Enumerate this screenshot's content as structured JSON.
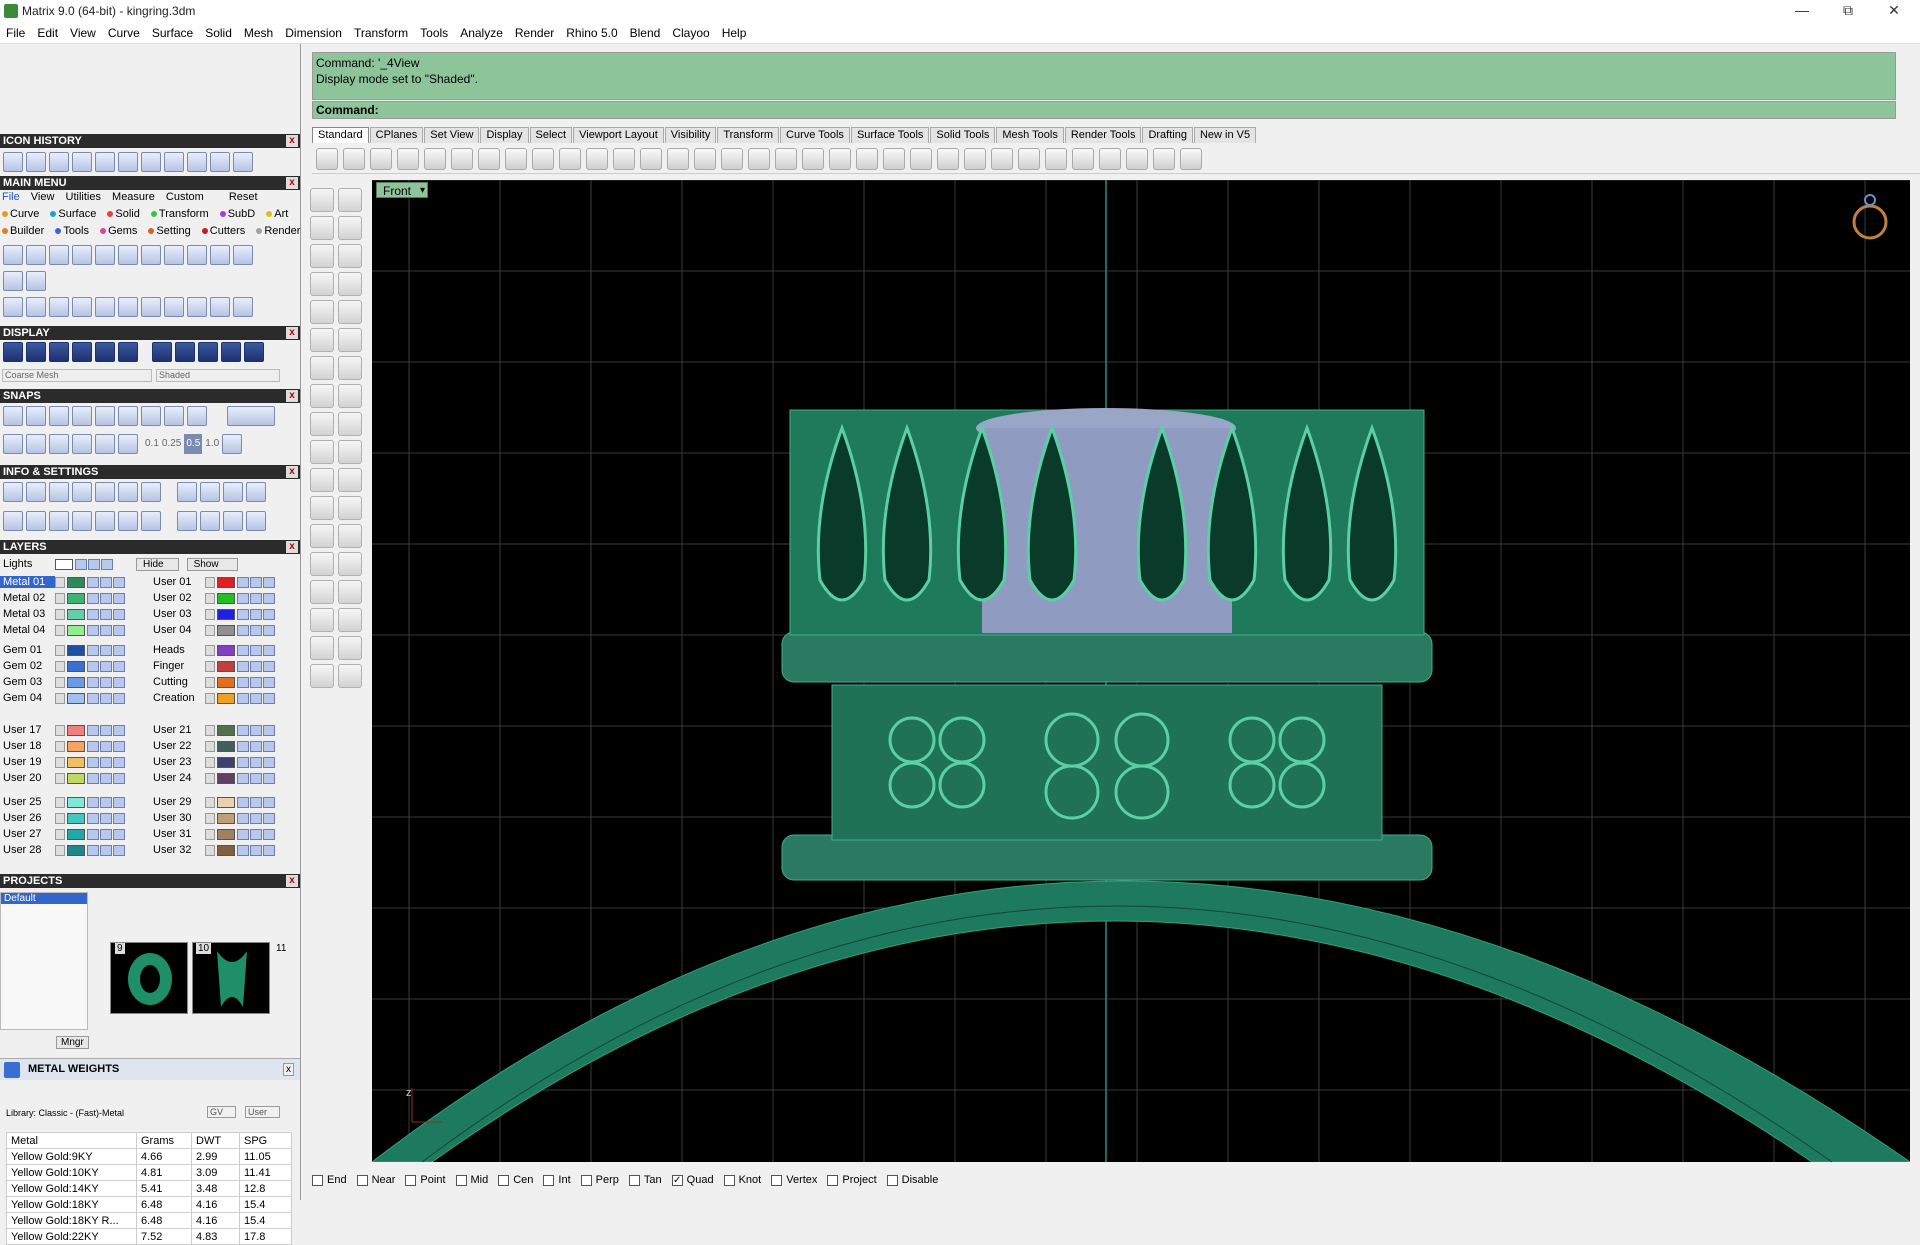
{
  "window": {
    "title": "Matrix 9.0 (64-bit) - kingring.3dm"
  },
  "menu": [
    "File",
    "Edit",
    "View",
    "Curve",
    "Surface",
    "Solid",
    "Mesh",
    "Dimension",
    "Transform",
    "Tools",
    "Analyze",
    "Render",
    "Rhino 5.0",
    "Blend",
    "Clayoo",
    "Help"
  ],
  "panels": {
    "icon_history": "ICON HISTORY",
    "main_menu": "MAIN MENU",
    "display": "DISPLAY",
    "snaps": "SNAPS",
    "info_settings": "INFO & SETTINGS",
    "layers": "LAYERS",
    "projects": "PROJECTS",
    "metal_weights": "METAL WEIGHTS"
  },
  "main_menu": {
    "row1": [
      "File",
      "View",
      "Utilities",
      "Measure",
      "Custom",
      "Reset"
    ],
    "row2": [
      "Curve",
      "Surface",
      "Solid",
      "Transform",
      "SubD",
      "Art"
    ],
    "row3": [
      "Builder",
      "Tools",
      "Gems",
      "Setting",
      "Cutters",
      "Render"
    ]
  },
  "display": {
    "mesh_option": "Coarse Mesh",
    "mode_option": "Shaded"
  },
  "snaps": {
    "values": [
      "0.1",
      "0.25",
      "0.5",
      "1.0"
    ]
  },
  "layers": {
    "lights": "Lights",
    "hide": "Hide",
    "show": "Show",
    "left": [
      {
        "name": "Metal 01",
        "color": "#2e8b57"
      },
      {
        "name": "Metal 02",
        "color": "#3cb371"
      },
      {
        "name": "Metal 03",
        "color": "#66cdaa"
      },
      {
        "name": "Metal 04",
        "color": "#90ee90"
      },
      {
        "name": "Gem 01",
        "color": "#1e4fa0"
      },
      {
        "name": "Gem 02",
        "color": "#3a6fd0"
      },
      {
        "name": "Gem 03",
        "color": "#6a9ae8"
      },
      {
        "name": "Gem 04",
        "color": "#a0c0f0"
      },
      {
        "name": "User 17",
        "color": "#f08080"
      },
      {
        "name": "User 18",
        "color": "#f4a460"
      },
      {
        "name": "User 19",
        "color": "#f0c060"
      },
      {
        "name": "User 20",
        "color": "#c0d860"
      },
      {
        "name": "User 25",
        "color": "#80e8d8"
      },
      {
        "name": "User 26",
        "color": "#40c8c0"
      },
      {
        "name": "User 27",
        "color": "#20a8a8"
      },
      {
        "name": "User 28",
        "color": "#208888"
      }
    ],
    "right": [
      {
        "name": "User 01",
        "color": "#e02020"
      },
      {
        "name": "User 02",
        "color": "#20c020"
      },
      {
        "name": "User 03",
        "color": "#2020e0"
      },
      {
        "name": "User 04",
        "color": "#909090"
      },
      {
        "name": "Heads",
        "color": "#8040c0"
      },
      {
        "name": "Finger",
        "color": "#c04040"
      },
      {
        "name": "Cutting",
        "color": "#e07020"
      },
      {
        "name": "Creation",
        "color": "#f0a020"
      },
      {
        "name": "User 21",
        "color": "#507050"
      },
      {
        "name": "User 22",
        "color": "#406060"
      },
      {
        "name": "User 23",
        "color": "#404070"
      },
      {
        "name": "User 24",
        "color": "#604060"
      },
      {
        "name": "User 29",
        "color": "#e8d0b0"
      },
      {
        "name": "User 30",
        "color": "#c0a070"
      },
      {
        "name": "User 31",
        "color": "#a08060"
      },
      {
        "name": "User 32",
        "color": "#806040"
      }
    ]
  },
  "projects": {
    "list": [
      "Default"
    ],
    "thumbs": [
      "9",
      "10",
      "11"
    ],
    "mngr": "Mngr"
  },
  "metal_weights": {
    "library": "Library: Classic - (Fast)-Metal",
    "gv": "GV",
    "user": "User",
    "headers": [
      "Metal",
      "Grams",
      "DWT",
      "SPG"
    ],
    "rows": [
      [
        "Yellow Gold:9KY",
        "4.66",
        "2.99",
        "11.05"
      ],
      [
        "Yellow Gold:10KY",
        "4.81",
        "3.09",
        "11.41"
      ],
      [
        "Yellow Gold:14KY",
        "5.41",
        "3.48",
        "12.8"
      ],
      [
        "Yellow Gold:18KY",
        "6.48",
        "4.16",
        "15.4"
      ],
      [
        "Yellow Gold:18KY R...",
        "6.48",
        "4.16",
        "15.4"
      ],
      [
        "Yellow Gold:22KY",
        "7.52",
        "4.83",
        "17.8"
      ]
    ]
  },
  "command": {
    "history": [
      "Command: '_4View",
      "Display mode set to \"Shaded\"."
    ],
    "prompt": "Command:"
  },
  "tabs": [
    "Standard",
    "CPlanes",
    "Set View",
    "Display",
    "Select",
    "Viewport Layout",
    "Visibility",
    "Transform",
    "Curve Tools",
    "Surface Tools",
    "Solid Tools",
    "Mesh Tools",
    "Render Tools",
    "Drafting",
    "New in V5"
  ],
  "viewport": {
    "label": "Front",
    "axis": "z"
  },
  "osnaps": [
    {
      "label": "End",
      "checked": false
    },
    {
      "label": "Near",
      "checked": false
    },
    {
      "label": "Point",
      "checked": false
    },
    {
      "label": "Mid",
      "checked": false
    },
    {
      "label": "Cen",
      "checked": false
    },
    {
      "label": "Int",
      "checked": false
    },
    {
      "label": "Perp",
      "checked": false
    },
    {
      "label": "Tan",
      "checked": false
    },
    {
      "label": "Quad",
      "checked": true
    },
    {
      "label": "Knot",
      "checked": false
    },
    {
      "label": "Vertex",
      "checked": false
    },
    {
      "label": "Project",
      "checked": false
    },
    {
      "label": "Disable",
      "checked": false
    }
  ]
}
